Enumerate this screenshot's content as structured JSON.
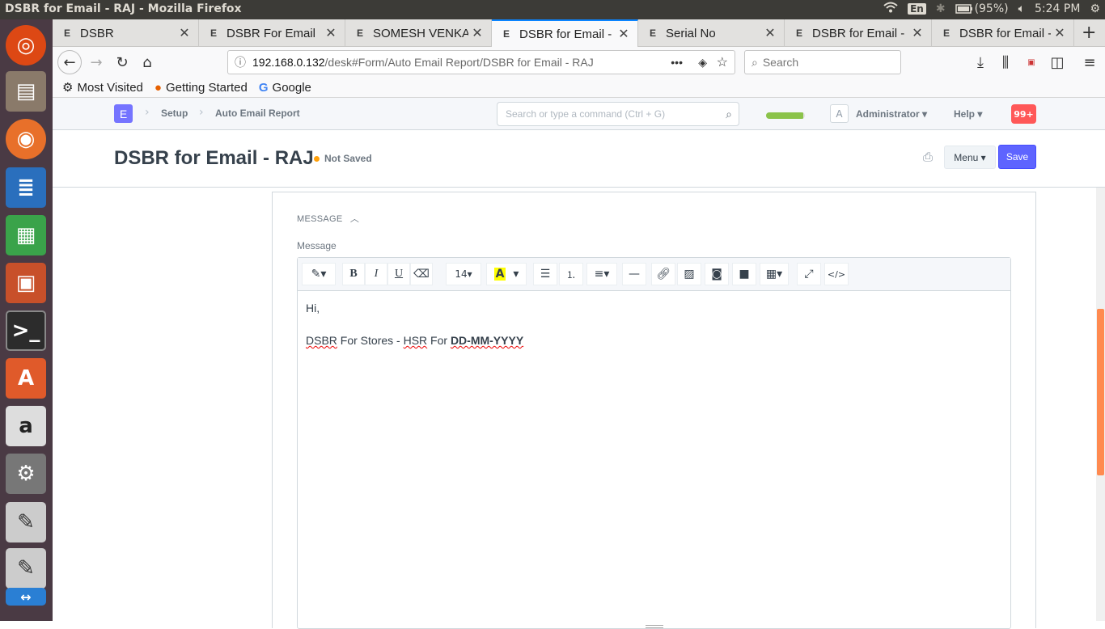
{
  "os": {
    "window_title": "DSBR for Email - RAJ - Mozilla Firefox",
    "lang": "En",
    "battery": "(95%)",
    "clock": "5:24 PM"
  },
  "browser": {
    "tabs": [
      {
        "label": "DSBR",
        "favicon": "E",
        "active": false
      },
      {
        "label": "DSBR For Email",
        "favicon": "E",
        "active": false
      },
      {
        "label": "SOMESH VENKAT",
        "favicon": "E",
        "active": false
      },
      {
        "label": "DSBR for Email - R",
        "favicon": "E",
        "active": true
      },
      {
        "label": "Serial No",
        "favicon": "E",
        "active": false
      },
      {
        "label": "DSBR for Email - L",
        "favicon": "E",
        "active": false
      },
      {
        "label": "DSBR for Email - E",
        "favicon": "E",
        "active": false
      }
    ],
    "url_host": "192.168.0.132",
    "url_path": "/desk#Form/Auto Email Report/DSBR for Email - RAJ",
    "search_placeholder": "Search",
    "bookmarks": [
      "Most Visited",
      "Getting Started",
      "Google"
    ]
  },
  "app": {
    "logo": "E",
    "breadcrumbs": [
      "Setup",
      "Auto Email Report"
    ],
    "awesomebar_placeholder": "Search or type a command (Ctrl + G)",
    "progress_fraction": 0.96,
    "avatar_letter": "A",
    "user_label": "Administrator",
    "help_label": "Help",
    "notification_count": "99+"
  },
  "form": {
    "title": "DSBR for Email - RAJ",
    "status": "Not Saved",
    "menu_label": "Menu",
    "save_label": "Save",
    "section_heading": "MESSAGE",
    "field_label": "Message",
    "font_size": "14",
    "message_line1": "Hi,",
    "message_line2_a": "DSBR",
    "message_line2_b": " For Stores - ",
    "message_line2_c": "HSR",
    "message_line2_d": " For ",
    "message_line2_bold": "DD-MM-YYYY"
  },
  "colors": {
    "accent": "#5e64ff",
    "notification": "#ff5858",
    "not_saved_dot": "#ffa00a"
  }
}
